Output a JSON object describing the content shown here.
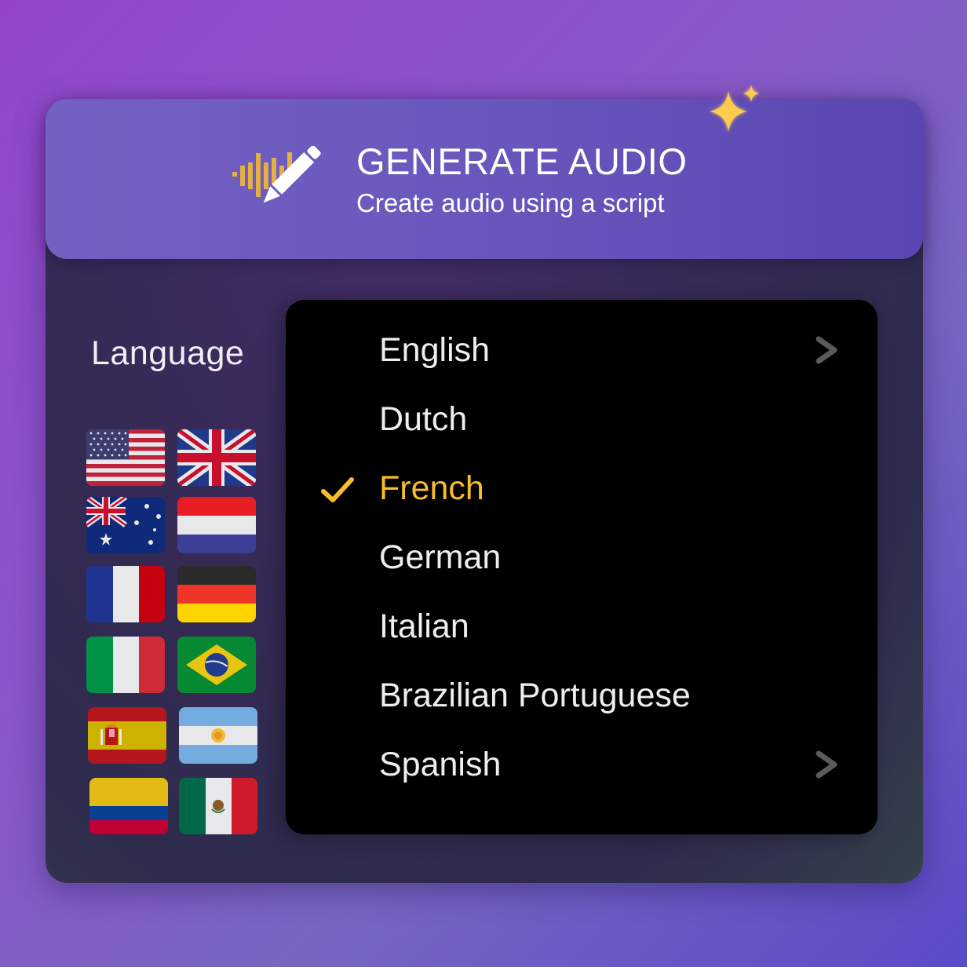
{
  "header": {
    "title": "GENERATE AUDIO",
    "subtitle": "Create audio using a script",
    "icon": "audio-waveform-pencil-icon",
    "decoration": "sparkles-icon"
  },
  "language_panel": {
    "label": "Language",
    "flags": [
      {
        "country": "United States"
      },
      {
        "country": "United Kingdom"
      },
      {
        "country": "Australia"
      },
      {
        "country": "Netherlands"
      },
      {
        "country": "France"
      },
      {
        "country": "Germany"
      },
      {
        "country": "Italy"
      },
      {
        "country": "Brazil"
      },
      {
        "country": "Spain"
      },
      {
        "country": "Argentina"
      },
      {
        "country": "Colombia"
      },
      {
        "country": "Mexico"
      }
    ]
  },
  "menu": {
    "selected": "French",
    "items": [
      {
        "label": "English",
        "has_submenu": true,
        "selected": false
      },
      {
        "label": "Dutch",
        "has_submenu": false,
        "selected": false
      },
      {
        "label": "French",
        "has_submenu": false,
        "selected": true
      },
      {
        "label": "German",
        "has_submenu": false,
        "selected": false
      },
      {
        "label": "Italian",
        "has_submenu": false,
        "selected": false
      },
      {
        "label": "Brazilian Portuguese",
        "has_submenu": false,
        "selected": false
      },
      {
        "label": "Spanish",
        "has_submenu": true,
        "selected": false
      }
    ]
  },
  "colors": {
    "accent_gold": "#f7bd2a",
    "header_purple": "#6957bd",
    "menu_bg": "#000000",
    "chevron_gray": "#5a5a5a"
  }
}
